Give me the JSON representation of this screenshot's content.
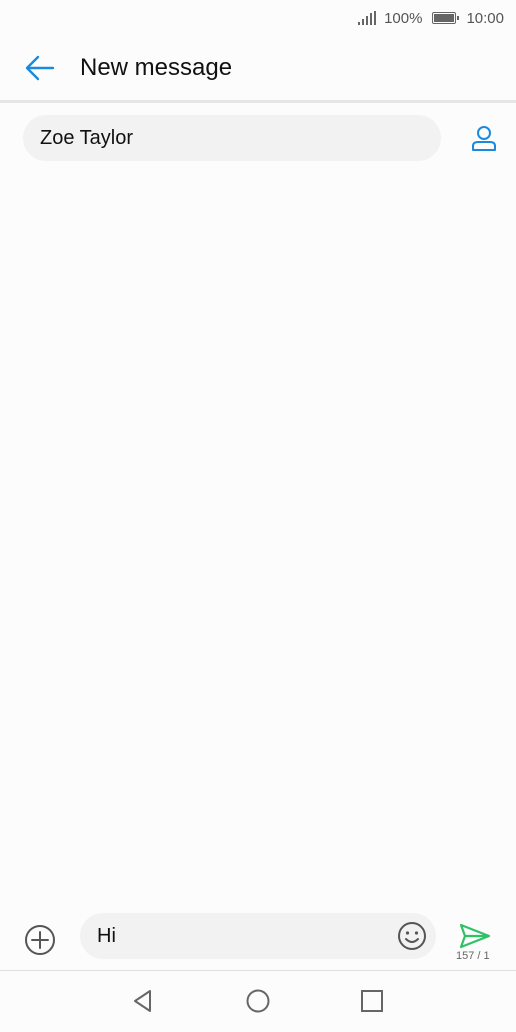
{
  "status_bar": {
    "battery_percent": "100%",
    "time": "10:00",
    "icons": [
      "signal-icon",
      "battery-icon"
    ]
  },
  "header": {
    "title": "New message",
    "back_icon": "arrow-left-icon",
    "accent_color": "#1a8ae0"
  },
  "recipient": {
    "value": "Zoe Taylor",
    "contact_icon": "person-icon"
  },
  "compose": {
    "message_text": "Hi",
    "char_counter": "157 / 1",
    "attach_icon": "plus-circle-icon",
    "emoji_icon": "smiley-icon",
    "send_icon": "send-icon",
    "send_color": "#2ec166"
  },
  "nav_bar": {
    "icons": [
      "back-triangle-icon",
      "home-circle-icon",
      "recents-square-icon"
    ]
  }
}
